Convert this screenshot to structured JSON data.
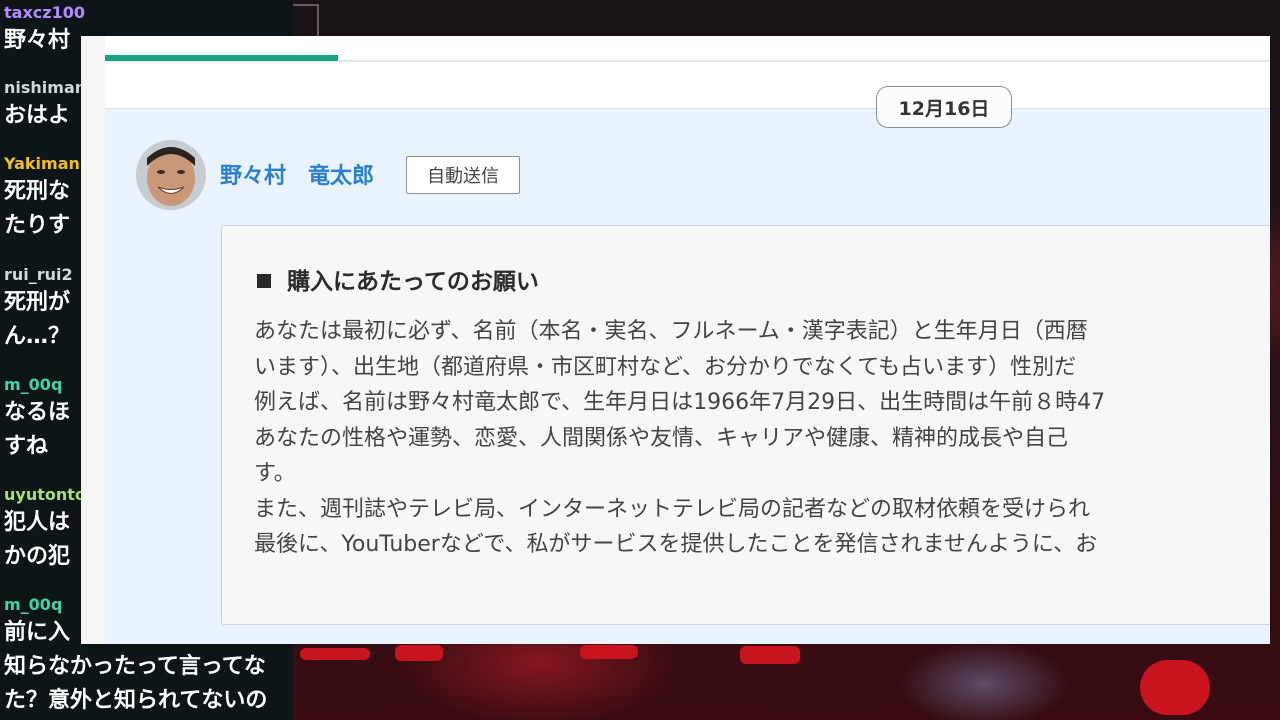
{
  "chat": {
    "messages": [
      {
        "user": "taxcz100",
        "user_color": "#b58cff",
        "lines": [
          "野々村"
        ]
      },
      {
        "user": "nishiman",
        "user_color": "#cfd8dc",
        "lines": [
          "おはよ"
        ]
      },
      {
        "user": "Yakiman",
        "user_color": "#f0c020",
        "lines": [
          "死刑な",
          "たりす"
        ]
      },
      {
        "user": "rui_rui2",
        "user_color": "#cfd8dc",
        "lines": [
          "死刑が",
          "ん…？"
        ]
      },
      {
        "user": "m_00q",
        "user_color": "#43d3a8",
        "lines": [
          "なるほ",
          "すね"
        ]
      },
      {
        "user": "uyutonto",
        "user_color": "#a8e070",
        "lines": [
          "犯人は",
          "かの犯"
        ]
      },
      {
        "user": "m_00q",
        "user_color": "#43d3a8",
        "lines": [
          "前に入",
          "知らなかったって言ってな",
          "た？意外と知られてないの"
        ]
      }
    ]
  },
  "window": {
    "progress_percent": 20,
    "date_label": "12月16日",
    "sender": {
      "name": "野々村　竜太郎",
      "tag": "自動送信"
    },
    "message": {
      "heading": "購入にあたってのお願い",
      "lines": [
        "あなたは最初に必ず、名前（本名・実名、フルネーム・漢字表記）と生年月日（西暦",
        "います）、出生地（都道府県・市区町村など、お分かりでなくても占います）性別だ",
        "例えば、名前は野々村竜太郎で、生年月日は1966年7月29日、出生時間は午前８時47",
        "あなたの性格や運勢、恋愛、人間関係や友情、キャリアや健康、精神的成長や自己",
        "す。",
        "また、週刊誌やテレビ局、インターネットテレビ局の記者などの取材依頼を受けられ",
        "最後に、YouTuberなどで、私がサービスを提供したことを発信されませんように、お"
      ]
    }
  },
  "colors": {
    "accent": "#19a384",
    "name_link": "#2a7fd0",
    "thread_bg": "#e8f3fd"
  }
}
